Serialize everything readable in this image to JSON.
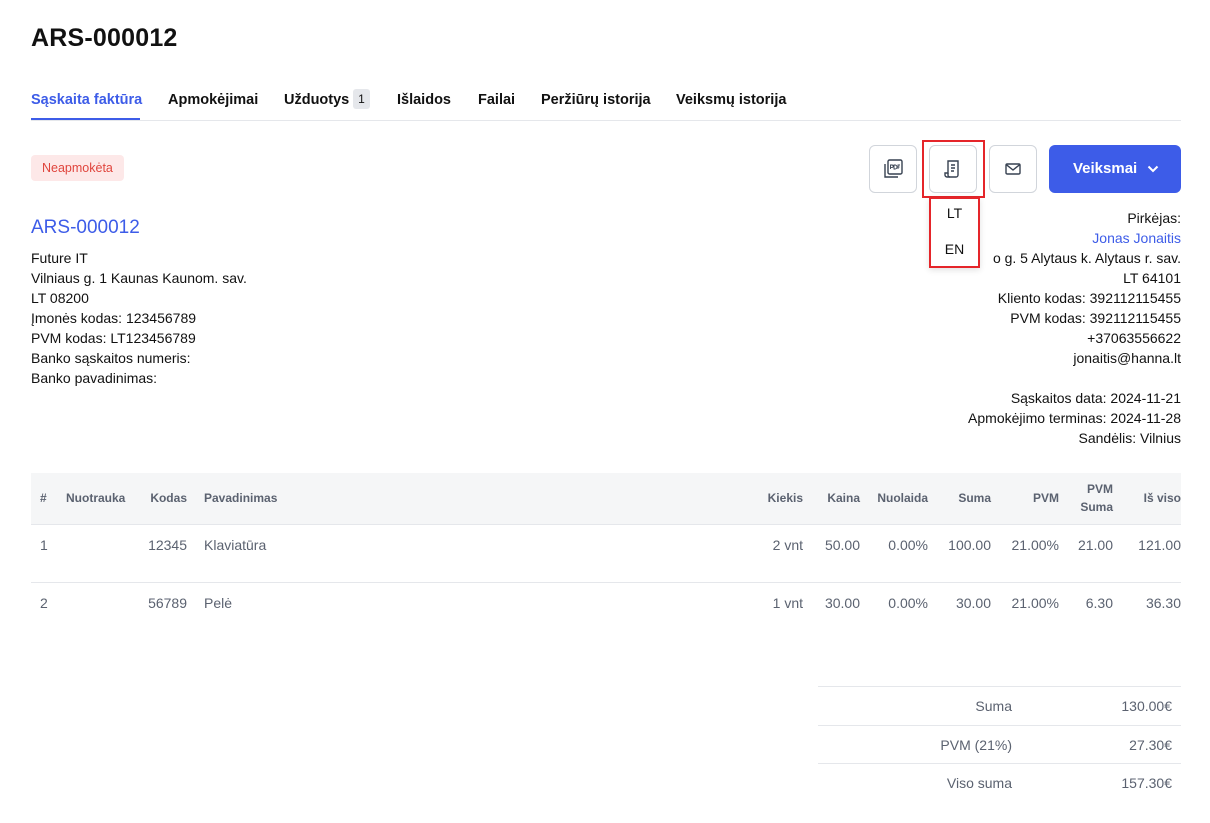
{
  "page_title": "ARS-000012",
  "tabs": [
    {
      "label": "Sąskaita faktūra"
    },
    {
      "label": "Apmokėjimai"
    },
    {
      "label": "Užduotys",
      "badge": "1"
    },
    {
      "label": "Išlaidos"
    },
    {
      "label": "Failai"
    },
    {
      "label": "Peržiūrų istorija"
    },
    {
      "label": "Veiksmų istorija"
    }
  ],
  "status": "Neapmokėta",
  "toolbar": {
    "icons": [
      "pdf-icon",
      "receipt-icon",
      "mail-icon"
    ],
    "actions_label": "Veiksmai"
  },
  "language_menu": [
    "LT",
    "EN"
  ],
  "invoice_number": "ARS-000012",
  "seller": [
    "Future IT",
    "Vilniaus g. 1 Kaunas Kaunom. sav.",
    "LT 08200",
    "Įmonės kodas: 123456789",
    "PVM kodas: LT123456789",
    "Banko sąskaitos numeris:",
    "Banko pavadinimas:"
  ],
  "buyer": {
    "label": "Pirkėjas:",
    "name": "Jonas Jonaitis",
    "address": "o g. 5 Alytaus k. Alytaus r. sav.",
    "postcode": "LT 64101",
    "client_code": "Kliento kodas: 392112115455",
    "vat_code": "PVM kodas: 392112115455",
    "phone": "+37063556622",
    "email": "jonaitis@hanna.lt"
  },
  "dates": {
    "invoice_date": "Sąskaitos data: 2024-11-21",
    "due_date": "Apmokėjimo terminas: 2024-11-28",
    "warehouse": "Sandėlis: Vilnius"
  },
  "table": {
    "columns": {
      "num": "#",
      "image": "Nuotrauka",
      "code": "Kodas",
      "name": "Pavadinimas",
      "qty": "Kiekis",
      "price": "Kaina",
      "discount": "Nuolaida",
      "sum": "Suma",
      "vat": "PVM",
      "vat_sum_1": "PVM",
      "vat_sum_2": "Suma",
      "total": "Iš viso"
    },
    "rows": [
      {
        "num": "1",
        "code": "12345",
        "name": "Klaviatūra",
        "qty": "2 vnt",
        "price": "50.00",
        "discount": "0.00%",
        "sum": "100.00",
        "vat": "21.00%",
        "vat_sum": "21.00",
        "total": "121.00"
      },
      {
        "num": "2",
        "code": "56789",
        "name": "Pelė",
        "qty": "1 vnt",
        "price": "30.00",
        "discount": "0.00%",
        "sum": "30.00",
        "vat": "21.00%",
        "vat_sum": "6.30",
        "total": "36.30"
      }
    ]
  },
  "totals": [
    {
      "label": "Suma",
      "value": "130.00€"
    },
    {
      "label": "PVM (21%)",
      "value": "27.30€"
    },
    {
      "label": "Viso suma",
      "value": "157.30€"
    }
  ]
}
